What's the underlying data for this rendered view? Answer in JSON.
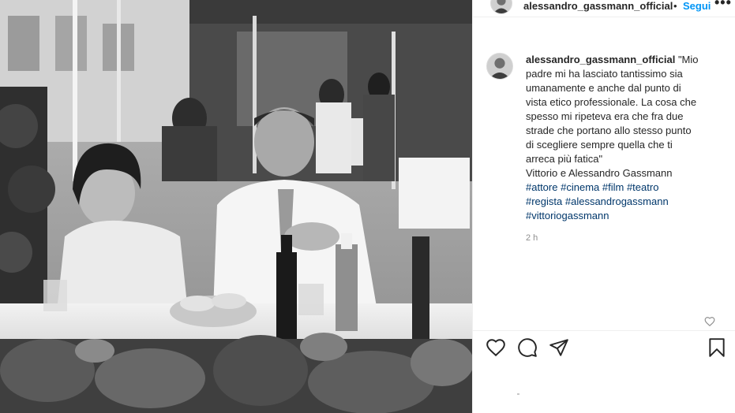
{
  "header": {
    "username": "alessandro_gassmann_official",
    "separator": "•",
    "follow_label": "Segui",
    "more_label": "•••",
    "avatar_icon": "profile-avatar"
  },
  "caption": {
    "username": "alessandro_gassmann_official",
    "lines": [
      "\"Mio",
      "padre mi ha lasciato tantissimo sia",
      "umanamente e anche dal punto di",
      "vista etico professionale. La cosa che",
      "spesso mi ripeteva era che fra due",
      "strade che portano allo stesso punto",
      "di scegliere sempre quella che ti",
      "arreca più fatica\"",
      "Vittorio e Alessandro Gassmann"
    ],
    "hashtag_lines": [
      [
        "#attore",
        "#cinema",
        "#film",
        "#teatro"
      ],
      [
        "#regista",
        "#alessandrogassmann"
      ],
      [
        "#vittoriogassmann"
      ]
    ],
    "time": "2 h"
  },
  "actions": {
    "like_icon": "heart-icon",
    "comment_icon": "comment-bubble-icon",
    "share_icon": "paper-plane-icon",
    "save_icon": "bookmark-icon"
  },
  "colors": {
    "link_blue": "#0095f6",
    "hashtag": "#00376b",
    "meta_gray": "#8e8e8e",
    "text": "#262626"
  }
}
